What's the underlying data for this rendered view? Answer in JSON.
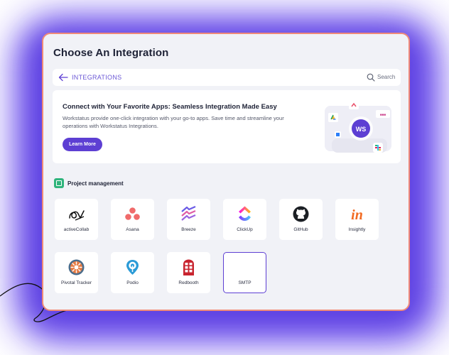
{
  "page_title": "Choose An Integration",
  "breadcrumb": {
    "label": "INTEGRATIONS"
  },
  "search": {
    "label": "Search"
  },
  "banner": {
    "heading": "Connect with Your Favorite Apps: Seamless Integration Made Easy",
    "body": "Workstatus provide one-click integration with your go-to apps. Save time and streamline your operations with Workstatus Integrations.",
    "button_label": "Learn More",
    "hub_logo": "WS",
    "hub_color": "#5d3fd3"
  },
  "section": {
    "label": "Project management",
    "icon": "project-management-icon"
  },
  "integrations": [
    {
      "name": "activeCollab",
      "icon": "activecollab-icon"
    },
    {
      "name": "Asana",
      "icon": "asana-icon"
    },
    {
      "name": "Breeze",
      "icon": "breeze-icon"
    },
    {
      "name": "ClickUp",
      "icon": "clickup-icon"
    },
    {
      "name": "GitHub",
      "icon": "github-icon"
    },
    {
      "name": "Insightly",
      "icon": "insightly-icon"
    },
    {
      "name": "Pivotal Tracker",
      "icon": "pivotal-tracker-icon"
    },
    {
      "name": "Podio",
      "icon": "podio-icon"
    },
    {
      "name": "Redbooth",
      "icon": "redbooth-icon"
    },
    {
      "name": "SMTP",
      "icon": "",
      "selected": true
    }
  ],
  "colors": {
    "accent": "#5d3fd3",
    "panel_border": "#f08a78",
    "backdrop": "#6d4ef0"
  }
}
